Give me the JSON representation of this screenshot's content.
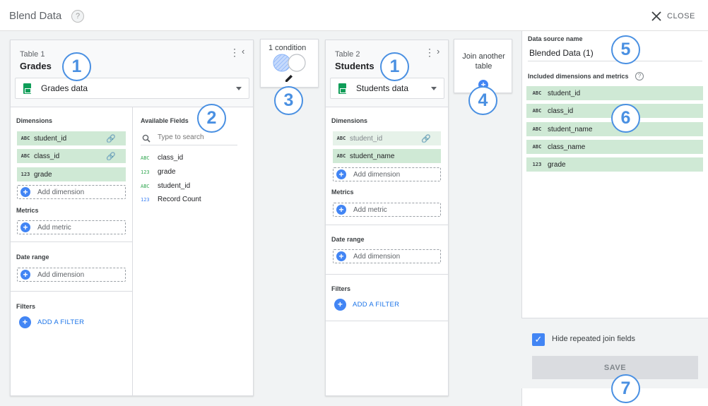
{
  "header": {
    "title": "Blend Data",
    "help": "?",
    "close_label": "CLOSE"
  },
  "table1": {
    "label": "Table 1",
    "name": "Grades",
    "source": "Grades data",
    "dimensions_label": "Dimensions",
    "dimensions": [
      {
        "type": "ABC",
        "name": "student_id"
      },
      {
        "type": "ABC",
        "name": "class_id"
      },
      {
        "type": "123",
        "name": "grade"
      }
    ],
    "add_dimension": "Add dimension",
    "metrics_label": "Metrics",
    "add_metric": "Add metric",
    "date_range_label": "Date range",
    "add_date_dimension": "Add dimension",
    "filters_label": "Filters",
    "add_filter": "ADD A FILTER"
  },
  "available": {
    "label": "Available Fields",
    "search_placeholder": "Type to search",
    "fields": [
      {
        "type": "ABC",
        "name": "class_id"
      },
      {
        "type": "123",
        "name": "grade"
      },
      {
        "type": "ABC",
        "name": "student_id"
      },
      {
        "type": "123",
        "name": "Record Count"
      }
    ]
  },
  "join": {
    "label": "1 condition"
  },
  "table2": {
    "label": "Table 2",
    "name": "Students",
    "source": "Students data",
    "dimensions_label": "Dimensions",
    "dimensions": [
      {
        "type": "ABC",
        "name": "student_id"
      },
      {
        "type": "ABC",
        "name": "student_name"
      }
    ],
    "add_dimension": "Add dimension",
    "metrics_label": "Metrics",
    "add_metric": "Add metric",
    "date_range_label": "Date range",
    "add_date_dimension": "Add dimension",
    "filters_label": "Filters",
    "add_filter": "ADD A FILTER"
  },
  "join_another": {
    "label": "Join another table"
  },
  "right": {
    "ds_label": "Data source name",
    "ds_value": "Blended Data (1)",
    "included_label": "Included dimensions and metrics",
    "included": [
      {
        "type": "ABC",
        "name": "student_id"
      },
      {
        "type": "ABC",
        "name": "class_id"
      },
      {
        "type": "ABC",
        "name": "student_name"
      },
      {
        "type": "ABC",
        "name": "class_name"
      },
      {
        "type": "123",
        "name": "grade"
      }
    ],
    "hide_repeated": "Hide repeated join fields",
    "save": "SAVE"
  },
  "markers": [
    "1",
    "2",
    "3",
    "1",
    "4",
    "5",
    "6",
    "7"
  ],
  "colors": {
    "accent": "#4285f4",
    "marker": "#4a90e2",
    "chip": "#cfe9d5",
    "sheet_green": "#0f9d58"
  }
}
